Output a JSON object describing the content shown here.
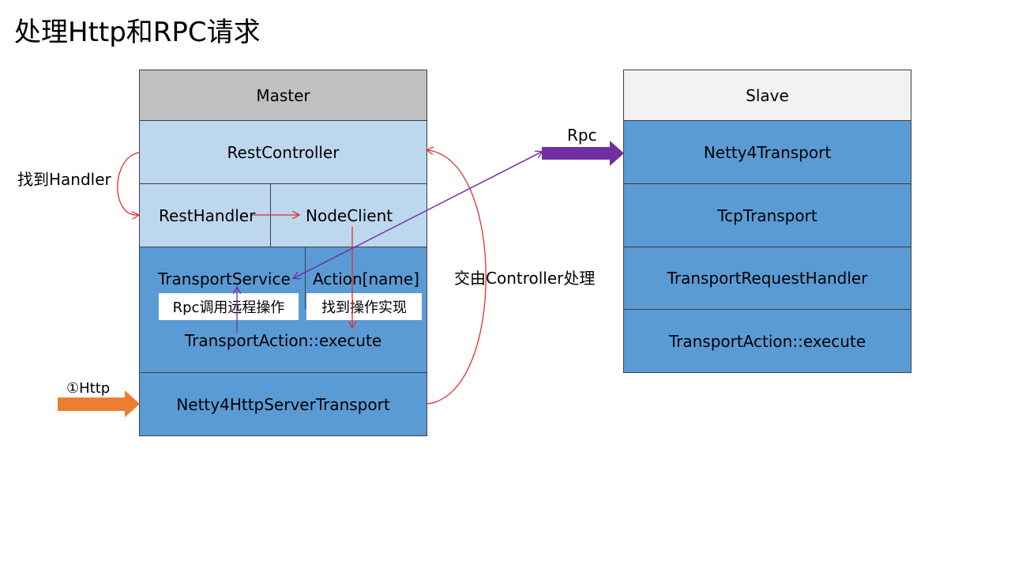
{
  "title": "处理Http和RPC请求",
  "master": {
    "header": "Master",
    "rest_controller": "RestController",
    "rest_handler": "RestHandler",
    "node_client": "NodeClient",
    "transport_service": "TransportService",
    "action_name": "Action[name]",
    "transport_action_execute": "TransportAction::execute",
    "netty_http_server_transport": "Netty4HttpServerTransport"
  },
  "slave": {
    "header": "Slave",
    "netty_transport": "Netty4Transport",
    "tcp_transport": "TcpTransport",
    "transport_request_handler": "TransportRequestHandler",
    "transport_action_execute": "TransportAction::execute"
  },
  "labels": {
    "find_handler": "找到Handler",
    "rpc": "Rpc",
    "controller_handle": "交由Controller处理",
    "http": "①Http",
    "rpc_remote_call": "Rpc调用远程操作",
    "find_action_impl": "找到操作实现"
  },
  "colors": {
    "header_master": "#c0c0c0",
    "header_slave": "#f2f2f2",
    "light_blue": "#bdd7ee",
    "blue": "#5b9bd5",
    "red_arrow": "#e03030",
    "purple_arrow": "#7030a0",
    "orange_arrow": "#ed7d31"
  }
}
